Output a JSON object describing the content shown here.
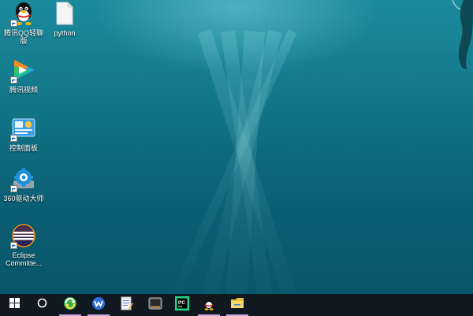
{
  "desktop_icons": [
    {
      "label": "腾讯QQ轻聊\n版",
      "icon": "qq-penguin-icon"
    },
    {
      "label": "python",
      "icon": "blank-file-icon"
    },
    {
      "label": "腾讯视频",
      "icon": "tencent-video-icon"
    },
    {
      "label": "控制面板",
      "icon": "control-panel-icon"
    },
    {
      "label": "360驱动大师",
      "icon": "driver-master-icon"
    },
    {
      "label": "Eclipse\nCommitte...",
      "icon": "eclipse-icon"
    }
  ],
  "taskbar": {
    "items": [
      {
        "icon": "windows-start-icon",
        "running": false
      },
      {
        "icon": "cortana-search-icon",
        "running": false
      },
      {
        "icon": "browser-360-icon",
        "running": true
      },
      {
        "icon": "wps-office-icon",
        "running": true
      },
      {
        "icon": "notepad-icon",
        "running": false
      },
      {
        "icon": "media-player-icon",
        "running": false
      },
      {
        "icon": "pycharm-icon",
        "running": false
      },
      {
        "icon": "qq-icon",
        "running": true
      },
      {
        "icon": "file-explorer-icon",
        "running": true
      }
    ]
  },
  "colors": {
    "wallpaper_top": "#1a8a9c",
    "wallpaper_bottom": "#0a566a",
    "taskbar_bg": "#101820",
    "running_indicator": "#c9a6df"
  }
}
